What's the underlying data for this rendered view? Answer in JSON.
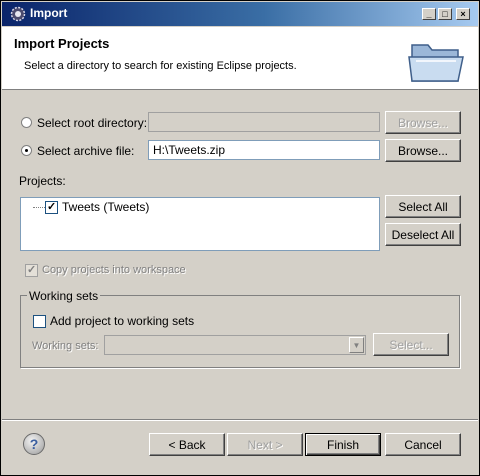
{
  "window": {
    "title": "Import",
    "controls": {
      "minimize": "_",
      "maximize": "□",
      "close": "×"
    },
    "app_icon": "eclipse-gear-icon"
  },
  "header": {
    "title": "Import Projects",
    "description": "Select a directory to search for existing Eclipse projects.",
    "icon": "folder-icon"
  },
  "source": {
    "root_dir_label": "Select root directory:",
    "root_dir_value": "",
    "root_dir_selected": false,
    "archive_label": "Select archive file:",
    "archive_value": "H:\\Tweets.zip",
    "archive_selected": true,
    "browse_label": "Browse..."
  },
  "projects": {
    "label": "Projects:",
    "items": [
      {
        "label": "Tweets (Tweets)",
        "checked": true
      }
    ],
    "select_all": "Select All",
    "deselect_all": "Deselect All"
  },
  "options": {
    "copy_label": "Copy projects into workspace",
    "copy_checked": true,
    "copy_enabled": false
  },
  "working_sets": {
    "group_label": "Working sets",
    "add_label": "Add project to working sets",
    "add_checked": false,
    "sets_label": "Working sets:",
    "sets_value": "",
    "select_label": "Select..."
  },
  "footer": {
    "back": "< Back",
    "next": "Next >",
    "finish": "Finish",
    "cancel": "Cancel",
    "help_icon": "help-icon"
  }
}
